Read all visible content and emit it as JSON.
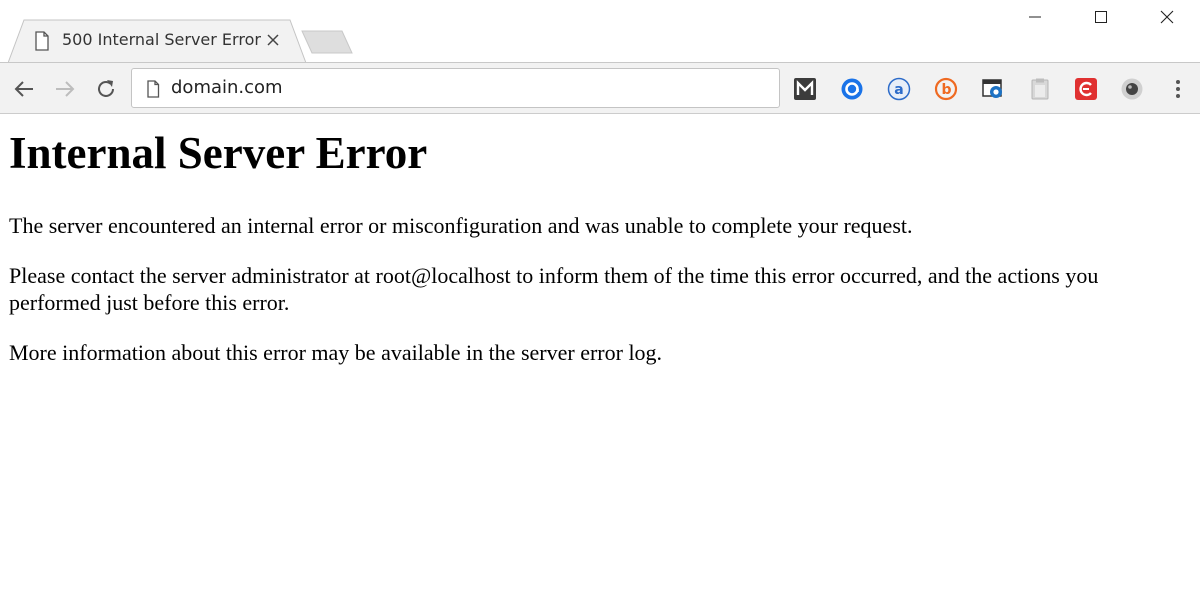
{
  "browser": {
    "tab": {
      "title": "500 Internal Server Error",
      "icon": "page-icon",
      "close_icon": "close-icon"
    },
    "window_controls": [
      "minimize-icon",
      "maximize-icon",
      "close-icon"
    ],
    "omnibox": {
      "url": "domain.com",
      "icon": "page-icon"
    },
    "extensions": [
      {
        "icon": "mailtrack-m-icon",
        "color": "#3c3c3c"
      },
      {
        "icon": "at-sign-blue-icon",
        "color": "#1a73e8"
      },
      {
        "icon": "at-sign-circle-icon",
        "color": "#2c6bc9"
      },
      {
        "icon": "b-orange-icon",
        "color": "#ef6a22"
      },
      {
        "icon": "screenshot-camera-icon",
        "color": "#1d72c4"
      },
      {
        "icon": "clipboard-icon",
        "color": "#bdbdbd"
      },
      {
        "icon": "red-shield-icon",
        "color": "#e03131"
      },
      {
        "icon": "dark-circle-icon",
        "color": "#444444"
      }
    ]
  },
  "page": {
    "heading": "Internal Server Error",
    "paragraphs": [
      "The server encountered an internal error or misconfiguration and was unable to complete your request.",
      "Please contact the server administrator at root@localhost to inform them of the time this error occurred, and the actions you performed just before this error.",
      "More information about this error may be available in the server error log."
    ]
  }
}
